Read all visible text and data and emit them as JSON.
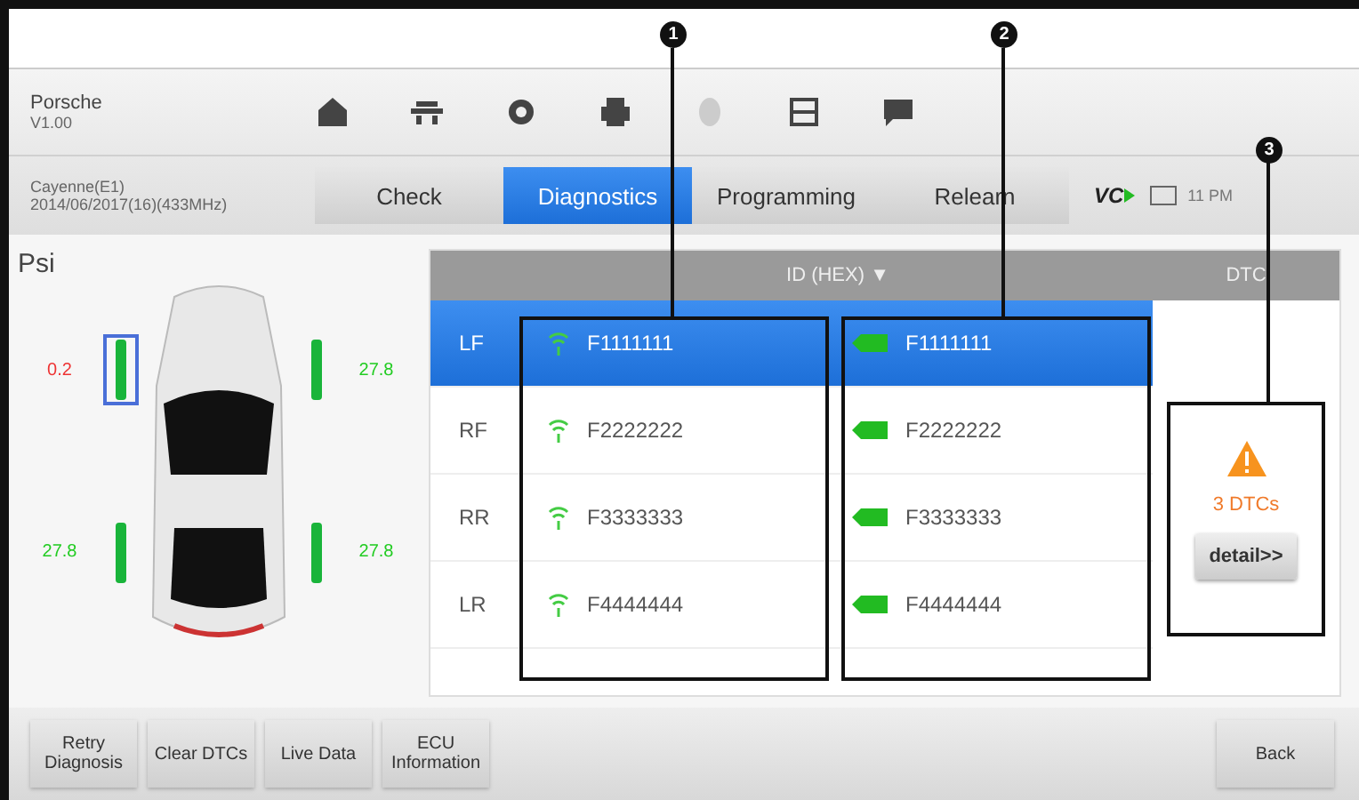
{
  "vehicle": {
    "make": "Porsche",
    "version": "V1.00",
    "model": "Cayenne(E1)",
    "info": "2014/06/2017(16)(433MHz)"
  },
  "tabs": [
    {
      "label": "Check",
      "selected": false
    },
    {
      "label": "Diagnostics",
      "selected": true
    },
    {
      "label": "Programming",
      "selected": false
    },
    {
      "label": "Relearn",
      "selected": false
    }
  ],
  "status": {
    "vci": "VC",
    "time": "11 PM"
  },
  "unit": "Psi",
  "tires": [
    {
      "reading": "0.2",
      "alert": true,
      "selected": true
    },
    {
      "reading": "27.8",
      "alert": false,
      "selected": false
    },
    {
      "reading": "27.8",
      "alert": false,
      "selected": false
    },
    {
      "reading": "27.8",
      "alert": false,
      "selected": false
    }
  ],
  "table": {
    "columns": [
      "ID (HEX) ▼",
      "DTC"
    ],
    "rows": [
      {
        "position": "LF",
        "sensor_id": "F1111111",
        "tool_id": "F1111111",
        "selected": true
      },
      {
        "position": "RF",
        "sensor_id": "F2222222",
        "tool_id": "F2222222",
        "selected": false
      },
      {
        "position": "RR",
        "sensor_id": "F3333333",
        "tool_id": "F3333333",
        "selected": false
      },
      {
        "position": "LR",
        "sensor_id": "F4444444",
        "tool_id": "F4444444",
        "selected": false
      }
    ]
  },
  "dtc": {
    "count": "3 DTCs",
    "button": "detail>>"
  },
  "buttons": [
    "Retry Diagnosis",
    "Clear DTCs",
    "Live Data",
    "ECU Information"
  ],
  "back": "Back",
  "callouts": [
    "1",
    "2",
    "3"
  ]
}
